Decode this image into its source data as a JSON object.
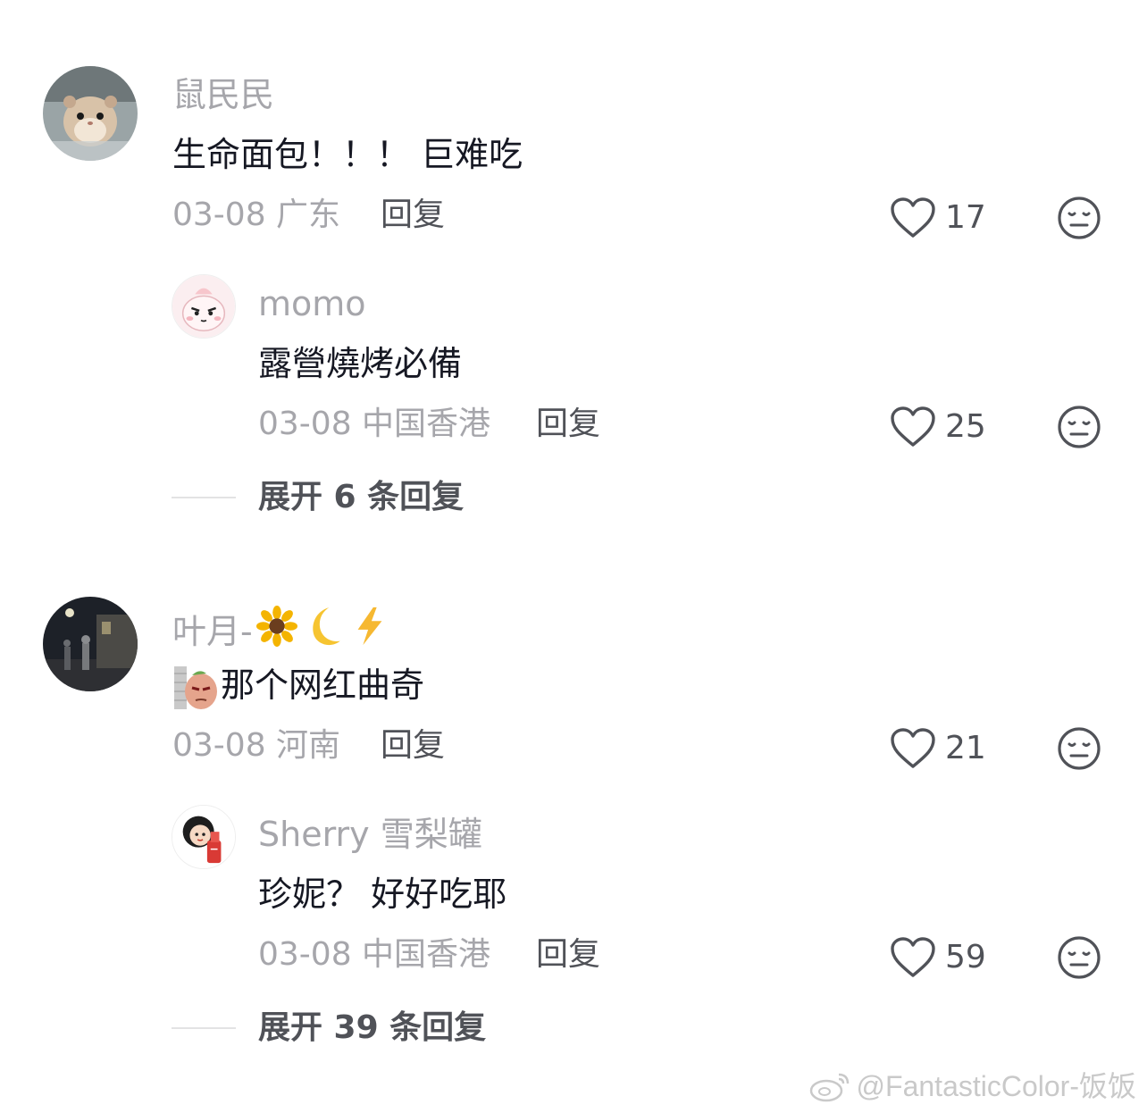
{
  "comments": [
    {
      "username": "鼠民民",
      "text": "生命面包！！！ 巨难吃",
      "date_location": "03-08 广东",
      "reply_label": "回复",
      "likes": "17",
      "avatar_icon": "hamster-avatar"
    },
    {
      "username": "momo",
      "text": "露營燒烤必備",
      "date_location": "03-08 中国香港",
      "reply_label": "回复",
      "likes": "25",
      "avatar_icon": "cartoon-pink-avatar"
    },
    {
      "expand_label": "展开 6 条回复"
    },
    {
      "username": "叶月-",
      "username_emojis": "🌻🌙⚡",
      "text": "那个网红曲奇",
      "date_location": "03-08 河南",
      "reply_label": "回复",
      "likes": "21",
      "avatar_icon": "night-street-avatar"
    },
    {
      "username": "Sherry 雪梨罐",
      "text": "珍妮？ 好好吃耶",
      "date_location": "03-08 中国香港",
      "reply_label": "回复",
      "likes": "59",
      "avatar_icon": "cartoon-girl-avatar"
    },
    {
      "expand_label": "展开 39 条回复"
    }
  ],
  "watermark": "@FantasticColor-饭饭",
  "colors": {
    "username": "#a6a6ab",
    "text": "#161823",
    "secondary": "#505258",
    "divider": "#e3e3e4"
  }
}
